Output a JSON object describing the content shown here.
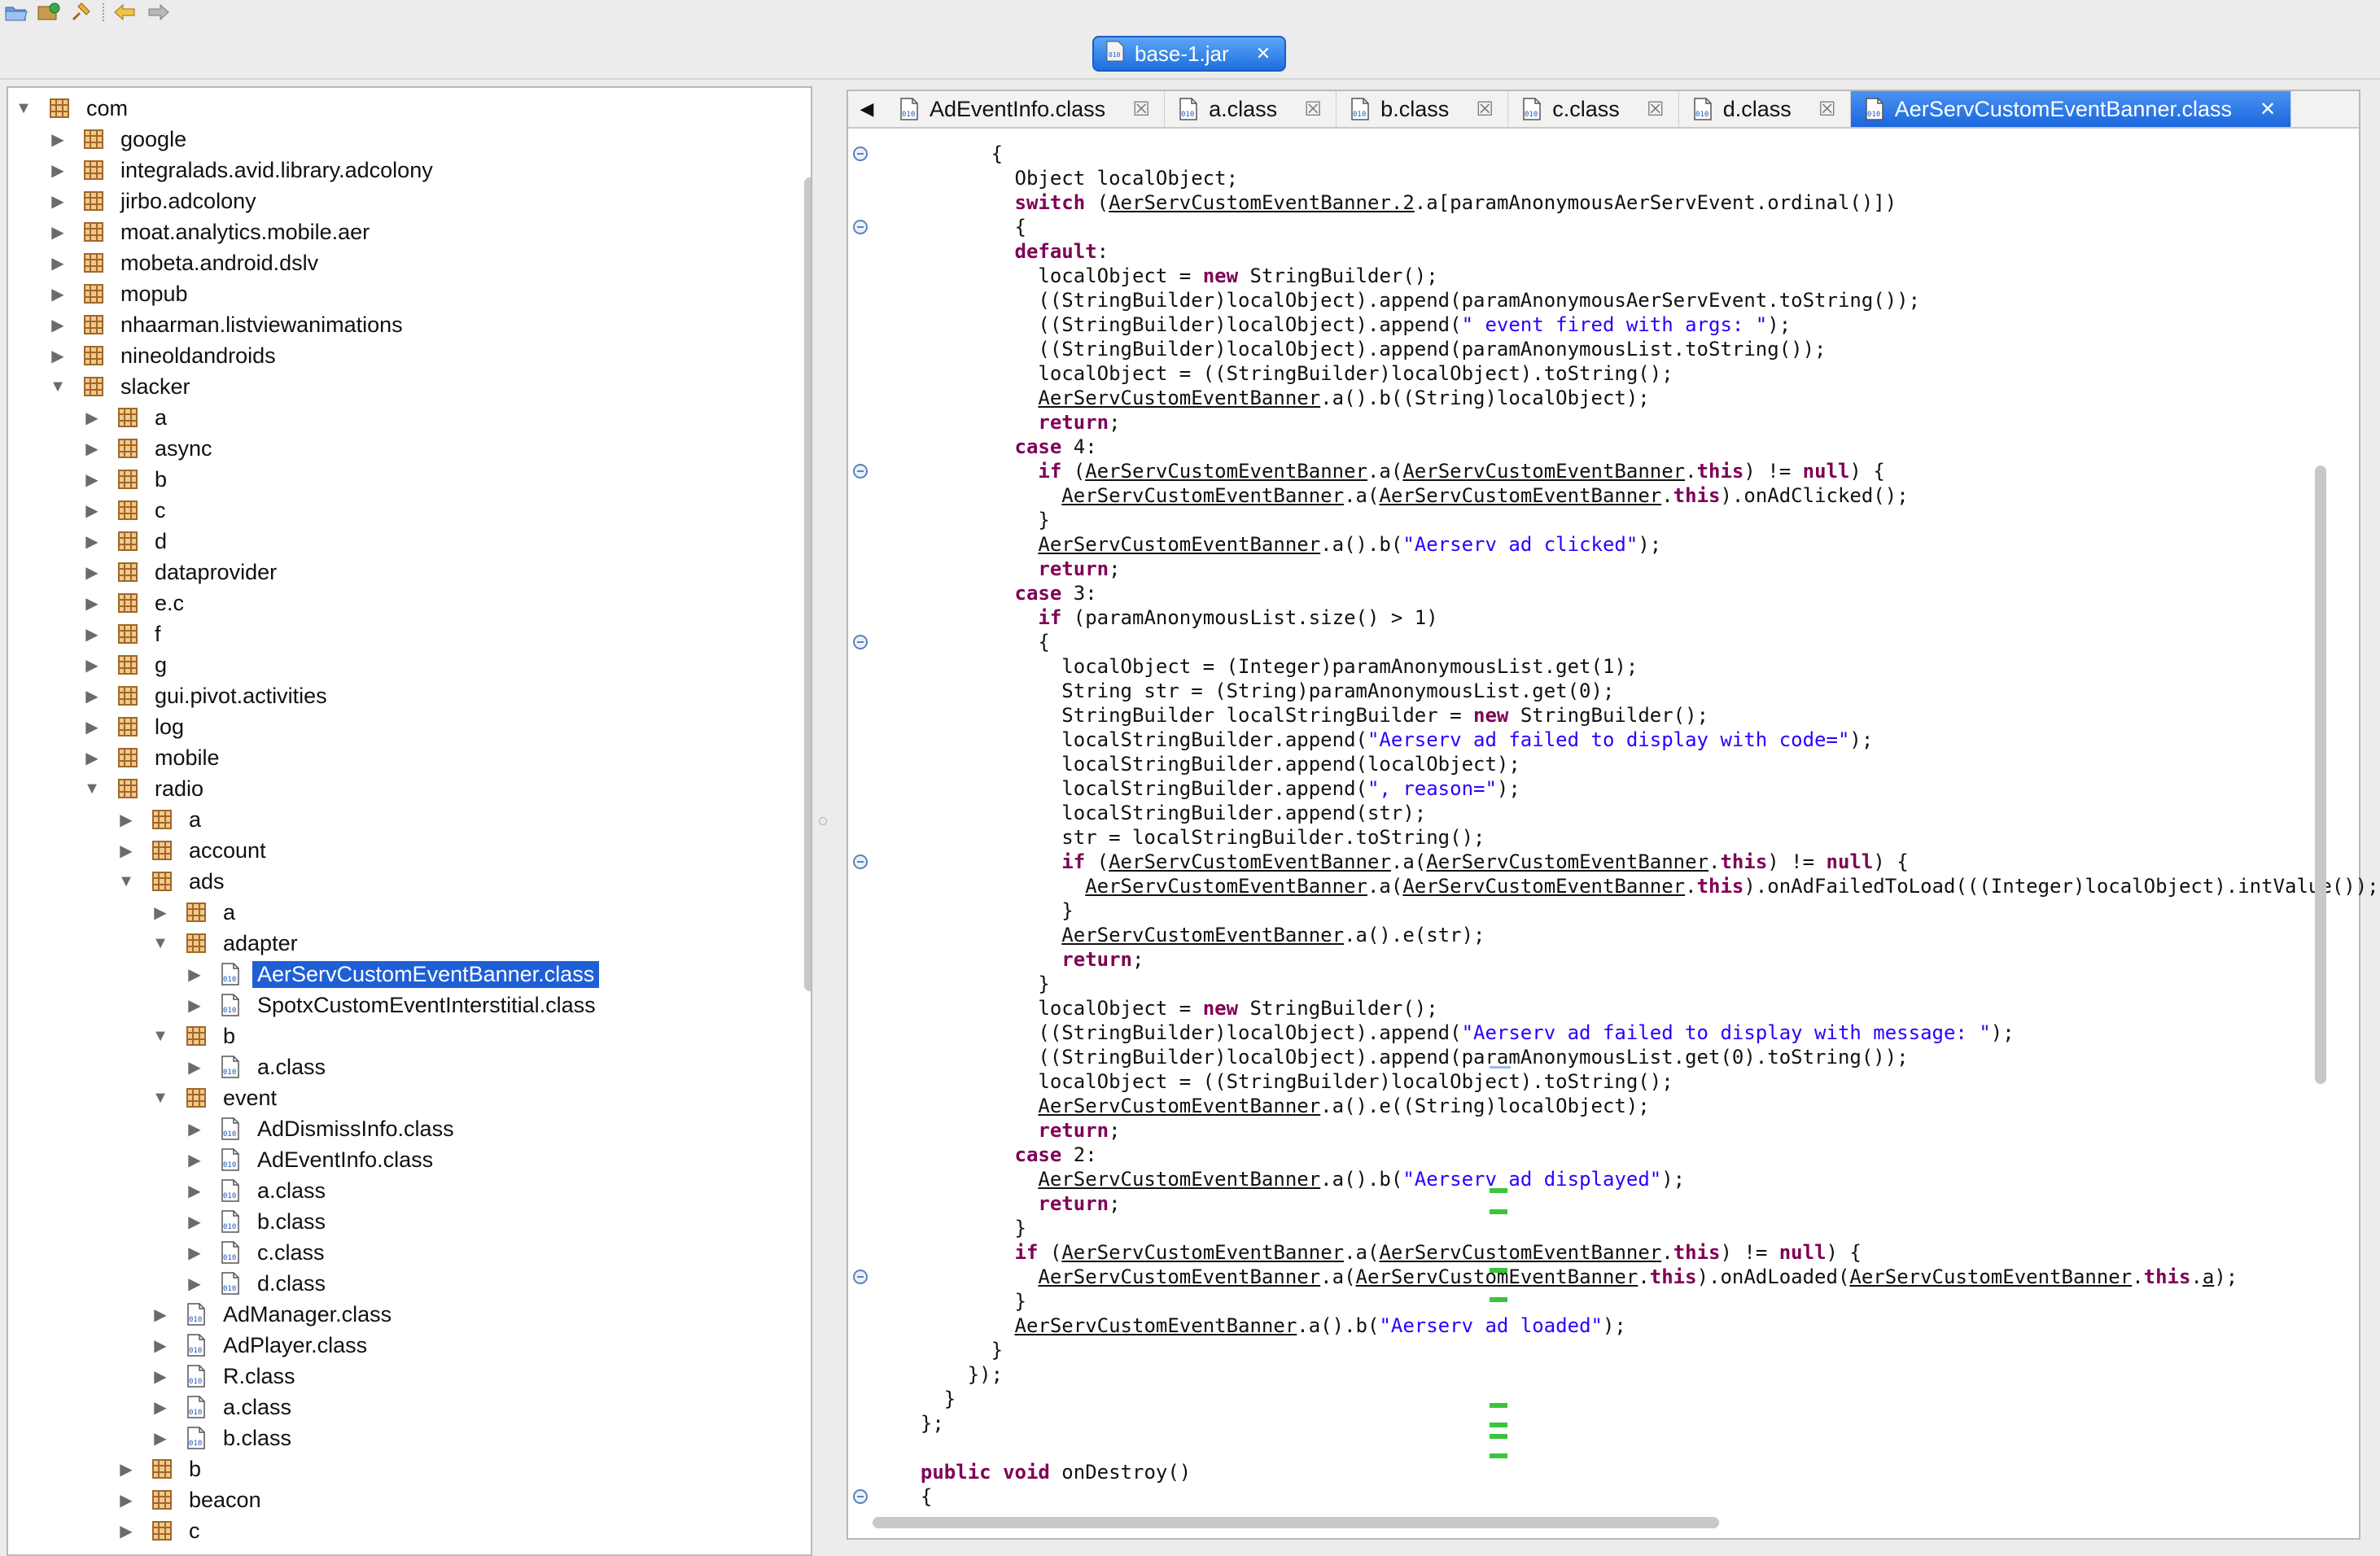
{
  "jar_tab": {
    "label": "base-1.jar"
  },
  "toolbar": {
    "icons": [
      "open-folder-icon",
      "open-archive-icon",
      "pin-icon",
      "back-arrow-icon",
      "forward-arrow-icon"
    ]
  },
  "colors": {
    "selection": "#1f5fd6",
    "keyword": "#7f0055",
    "string": "#2a00ff",
    "package": "#a0672a"
  },
  "tree": [
    {
      "label": "com",
      "depth": 0,
      "expanded": true,
      "type": "package"
    },
    {
      "label": "google",
      "depth": 1,
      "expanded": false,
      "type": "package"
    },
    {
      "label": "integralads.avid.library.adcolony",
      "depth": 1,
      "expanded": false,
      "type": "package"
    },
    {
      "label": "jirbo.adcolony",
      "depth": 1,
      "expanded": false,
      "type": "package"
    },
    {
      "label": "moat.analytics.mobile.aer",
      "depth": 1,
      "expanded": false,
      "type": "package"
    },
    {
      "label": "mobeta.android.dslv",
      "depth": 1,
      "expanded": false,
      "type": "package"
    },
    {
      "label": "mopub",
      "depth": 1,
      "expanded": false,
      "type": "package"
    },
    {
      "label": "nhaarman.listviewanimations",
      "depth": 1,
      "expanded": false,
      "type": "package"
    },
    {
      "label": "nineoldandroids",
      "depth": 1,
      "expanded": false,
      "type": "package"
    },
    {
      "label": "slacker",
      "depth": 1,
      "expanded": true,
      "type": "package"
    },
    {
      "label": "a",
      "depth": 2,
      "expanded": false,
      "type": "package"
    },
    {
      "label": "async",
      "depth": 2,
      "expanded": false,
      "type": "package"
    },
    {
      "label": "b",
      "depth": 2,
      "expanded": false,
      "type": "package"
    },
    {
      "label": "c",
      "depth": 2,
      "expanded": false,
      "type": "package"
    },
    {
      "label": "d",
      "depth": 2,
      "expanded": false,
      "type": "package"
    },
    {
      "label": "dataprovider",
      "depth": 2,
      "expanded": false,
      "type": "package"
    },
    {
      "label": "e.c",
      "depth": 2,
      "expanded": false,
      "type": "package"
    },
    {
      "label": "f",
      "depth": 2,
      "expanded": false,
      "type": "package"
    },
    {
      "label": "g",
      "depth": 2,
      "expanded": false,
      "type": "package"
    },
    {
      "label": "gui.pivot.activities",
      "depth": 2,
      "expanded": false,
      "type": "package"
    },
    {
      "label": "log",
      "depth": 2,
      "expanded": false,
      "type": "package"
    },
    {
      "label": "mobile",
      "depth": 2,
      "expanded": false,
      "type": "package"
    },
    {
      "label": "radio",
      "depth": 2,
      "expanded": true,
      "type": "package"
    },
    {
      "label": "a",
      "depth": 3,
      "expanded": false,
      "type": "package"
    },
    {
      "label": "account",
      "depth": 3,
      "expanded": false,
      "type": "package"
    },
    {
      "label": "ads",
      "depth": 3,
      "expanded": true,
      "type": "package"
    },
    {
      "label": "a",
      "depth": 4,
      "expanded": false,
      "type": "package"
    },
    {
      "label": "adapter",
      "depth": 4,
      "expanded": true,
      "type": "package"
    },
    {
      "label": "AerServCustomEventBanner.class",
      "depth": 5,
      "expanded": false,
      "type": "class",
      "selected": true
    },
    {
      "label": "SpotxCustomEventInterstitial.class",
      "depth": 5,
      "expanded": false,
      "type": "class"
    },
    {
      "label": "b",
      "depth": 4,
      "expanded": true,
      "type": "package"
    },
    {
      "label": "a.class",
      "depth": 5,
      "expanded": false,
      "type": "class"
    },
    {
      "label": "event",
      "depth": 4,
      "expanded": true,
      "type": "package"
    },
    {
      "label": "AdDismissInfo.class",
      "depth": 5,
      "expanded": false,
      "type": "class"
    },
    {
      "label": "AdEventInfo.class",
      "depth": 5,
      "expanded": false,
      "type": "class"
    },
    {
      "label": "a.class",
      "depth": 5,
      "expanded": false,
      "type": "class"
    },
    {
      "label": "b.class",
      "depth": 5,
      "expanded": false,
      "type": "class"
    },
    {
      "label": "c.class",
      "depth": 5,
      "expanded": false,
      "type": "class"
    },
    {
      "label": "d.class",
      "depth": 5,
      "expanded": false,
      "type": "class"
    },
    {
      "label": "AdManager.class",
      "depth": 4,
      "expanded": false,
      "type": "class"
    },
    {
      "label": "AdPlayer.class",
      "depth": 4,
      "expanded": false,
      "type": "class"
    },
    {
      "label": "R.class",
      "depth": 4,
      "expanded": false,
      "type": "class"
    },
    {
      "label": "a.class",
      "depth": 4,
      "expanded": false,
      "type": "class"
    },
    {
      "label": "b.class",
      "depth": 4,
      "expanded": false,
      "type": "class"
    },
    {
      "label": "b",
      "depth": 3,
      "expanded": false,
      "type": "package"
    },
    {
      "label": "beacon",
      "depth": 3,
      "expanded": false,
      "type": "package"
    },
    {
      "label": "c",
      "depth": 3,
      "expanded": false,
      "type": "package"
    }
  ],
  "editor_tabs": [
    {
      "label": "AdEventInfo.class",
      "active": false
    },
    {
      "label": "a.class",
      "active": false
    },
    {
      "label": "b.class",
      "active": false
    },
    {
      "label": "c.class",
      "active": false
    },
    {
      "label": "d.class",
      "active": false
    },
    {
      "label": "AerServCustomEventBanner.class",
      "active": true
    }
  ],
  "code_lines": [
    "        {",
    "          Object localObject;",
    "          switch (AerServCustomEventBanner.2.a[paramAnonymousAerServEvent.ordinal()])",
    "          {",
    "          default:",
    "            localObject = new StringBuilder();",
    "            ((StringBuilder)localObject).append(paramAnonymousAerServEvent.toString());",
    "            ((StringBuilder)localObject).append(\" event fired with args: \");",
    "            ((StringBuilder)localObject).append(paramAnonymousList.toString());",
    "            localObject = ((StringBuilder)localObject).toString();",
    "            AerServCustomEventBanner.a().b((String)localObject);",
    "            return;",
    "          case 4:",
    "            if (AerServCustomEventBanner.a(AerServCustomEventBanner.this) != null) {",
    "              AerServCustomEventBanner.a(AerServCustomEventBanner.this).onAdClicked();",
    "            }",
    "            AerServCustomEventBanner.a().b(\"Aerserv ad clicked\");",
    "            return;",
    "          case 3:",
    "            if (paramAnonymousList.size() > 1)",
    "            {",
    "              localObject = (Integer)paramAnonymousList.get(1);",
    "              String str = (String)paramAnonymousList.get(0);",
    "              StringBuilder localStringBuilder = new StringBuilder();",
    "              localStringBuilder.append(\"Aerserv ad failed to display with code=\");",
    "              localStringBuilder.append(localObject);",
    "              localStringBuilder.append(\", reason=\");",
    "              localStringBuilder.append(str);",
    "              str = localStringBuilder.toString();",
    "              if (AerServCustomEventBanner.a(AerServCustomEventBanner.this) != null) {",
    "                AerServCustomEventBanner.a(AerServCustomEventBanner.this).onAdFailedToLoad(((Integer)localObject).intValue());",
    "              }",
    "              AerServCustomEventBanner.a().e(str);",
    "              return;",
    "            }",
    "            localObject = new StringBuilder();",
    "            ((StringBuilder)localObject).append(\"Aerserv ad failed to display with message: \");",
    "            ((StringBuilder)localObject).append(paramAnonymousList.get(0).toString());",
    "            localObject = ((StringBuilder)localObject).toString();",
    "            AerServCustomEventBanner.a().e((String)localObject);",
    "            return;",
    "          case 2:",
    "            AerServCustomEventBanner.a().b(\"Aerserv ad displayed\");",
    "            return;",
    "          }",
    "          if (AerServCustomEventBanner.a(AerServCustomEventBanner.this) != null) {",
    "            AerServCustomEventBanner.a(AerServCustomEventBanner.this).onAdLoaded(AerServCustomEventBanner.this.a);",
    "          }",
    "          AerServCustomEventBanner.a().b(\"Aerserv ad loaded\");",
    "        }",
    "      });",
    "    }",
    "  };",
    "",
    "  public void onDestroy()",
    "  {"
  ],
  "fold_lines": [
    0,
    3,
    13,
    20,
    29,
    46,
    55
  ]
}
